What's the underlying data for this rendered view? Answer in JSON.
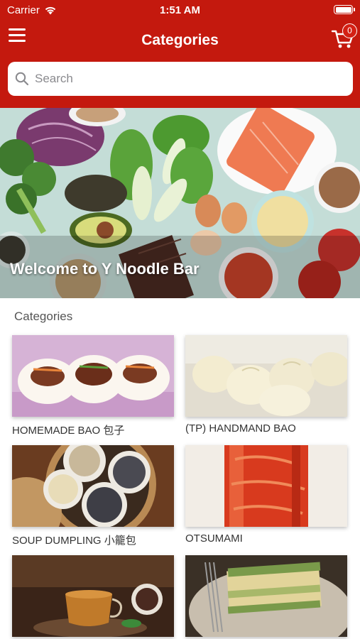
{
  "status_bar": {
    "carrier": "Carrier",
    "time": "1:51 AM"
  },
  "header": {
    "title": "Categories",
    "cart_count": "0"
  },
  "search": {
    "placeholder": "Search"
  },
  "hero": {
    "title": "Welcome to Y Noodle Bar"
  },
  "section": {
    "label": "Categories"
  },
  "categories": [
    {
      "label": "HOMEMADE BAO 包子"
    },
    {
      "label": "(TP) HANDMAND BAO"
    },
    {
      "label": "SOUP DUMPLING 小籠包"
    },
    {
      "label": "OTSUMAMI"
    },
    {
      "label": ""
    },
    {
      "label": ""
    }
  ],
  "colors": {
    "primary": "#c4190e",
    "background": "#ffffff"
  }
}
